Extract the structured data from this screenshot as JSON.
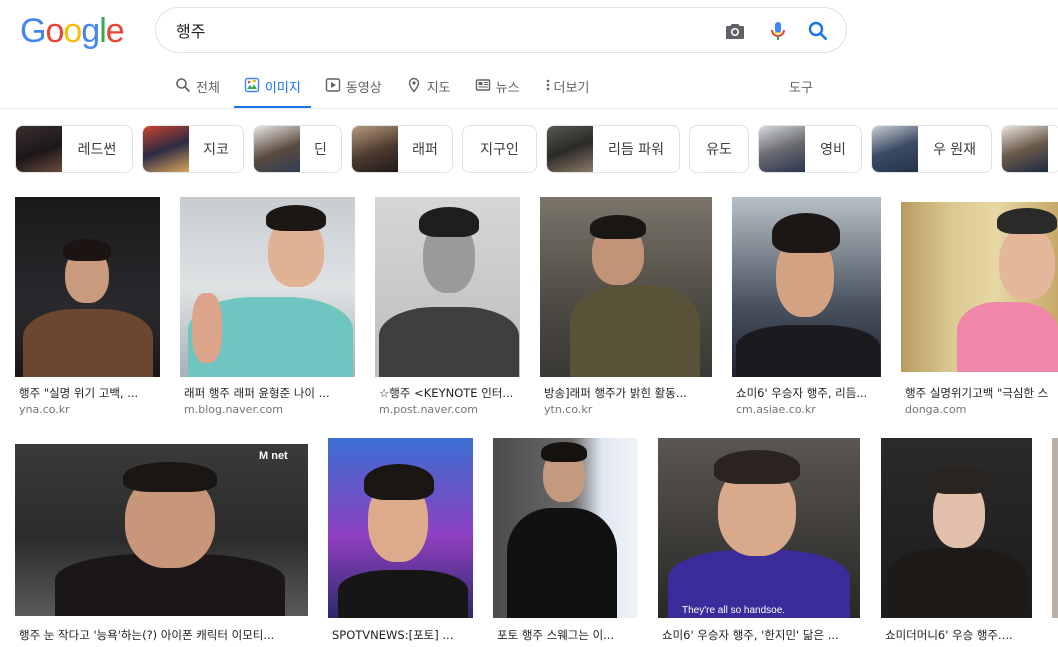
{
  "logo": {
    "text": "Google"
  },
  "search": {
    "query": "행주"
  },
  "tabs": [
    {
      "label": "전체",
      "icon": "search-icon"
    },
    {
      "label": "이미지",
      "icon": "image-icon",
      "active": true
    },
    {
      "label": "동영상",
      "icon": "video-icon"
    },
    {
      "label": "지도",
      "icon": "map-pin-icon"
    },
    {
      "label": "뉴스",
      "icon": "news-icon"
    },
    {
      "label": "더보기",
      "icon": "more-vert-icon"
    }
  ],
  "tools_label": "도구",
  "chips": [
    {
      "label": "레드썬"
    },
    {
      "label": "지코"
    },
    {
      "label": "딘"
    },
    {
      "label": "래퍼"
    },
    {
      "label": "지구인"
    },
    {
      "label": "리듬 파워"
    },
    {
      "label": "유도"
    },
    {
      "label": "영비"
    },
    {
      "label": "우 원재"
    },
    {
      "label": ""
    }
  ],
  "row1": [
    {
      "caption": "행주 \"실명 위기 고백, ...",
      "source": "yna.co.kr"
    },
    {
      "caption": "래퍼 행주 래퍼 윤형준 나이 ...",
      "source": "m.blog.naver.com"
    },
    {
      "caption": "☆행주 <KEYNOTE 인터...",
      "source": "m.post.naver.com"
    },
    {
      "caption": "방송]래퍼 행주가 밝힌 활동...",
      "source": "ytn.co.kr"
    },
    {
      "caption": "쇼미6' 우승자 행주, 리듬...",
      "source": "cm.asiae.co.kr"
    },
    {
      "caption": "행주 실명위기고백 \"극심한 스",
      "source": "donga.com"
    }
  ],
  "row2": [
    {
      "caption": "행주 눈 작다고 '능욕'하는(?) 아이폰 캐릭터 이모티...",
      "source": ""
    },
    {
      "caption": "SPOTVNEWS:[포토] ...",
      "source": ""
    },
    {
      "caption": "포토 행주 스웨그는 이...",
      "source": ""
    },
    {
      "caption": "쇼미6' 우승자 행주, '한지민' 닮은 ...",
      "source": ""
    },
    {
      "caption": "쇼미더머니6' 우승 행주....",
      "source": ""
    }
  ],
  "image_text": {
    "subtitle": "They're all so handsoe.",
    "mnet_logo": "M net"
  },
  "colors": {
    "accent": "#1a73e8",
    "google_blue": "#4285f4",
    "google_red": "#ea4335",
    "google_yellow": "#fbbc05",
    "google_green": "#34a853"
  }
}
